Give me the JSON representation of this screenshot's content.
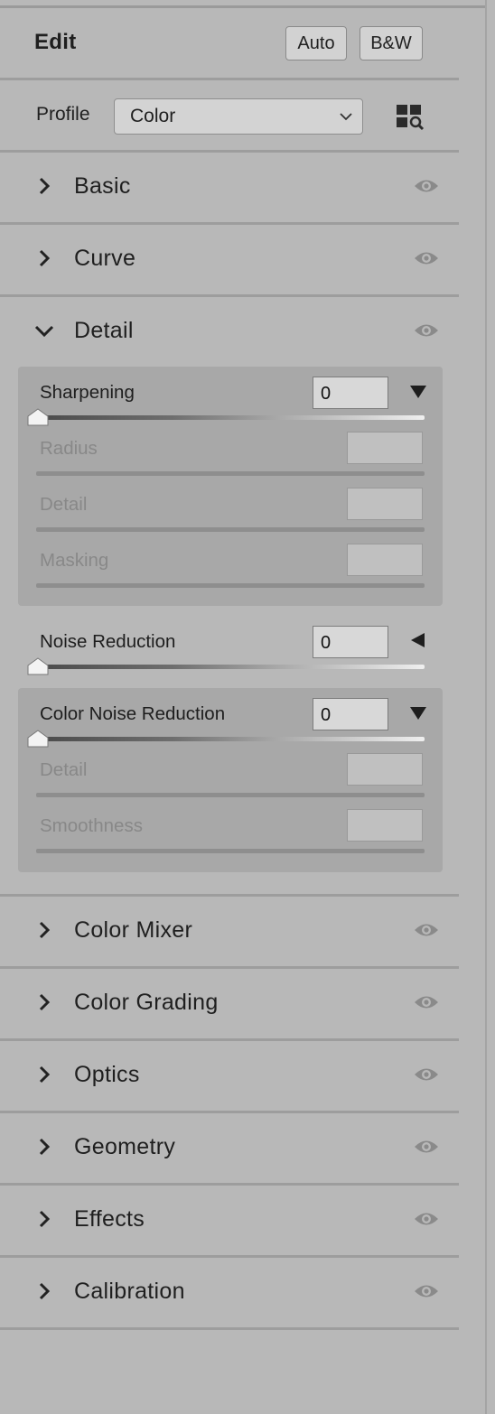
{
  "header": {
    "title": "Edit",
    "auto_label": "Auto",
    "bw_label": "B&W"
  },
  "profile": {
    "label": "Profile",
    "value": "Color",
    "browse_icon": "profile-browser-icon"
  },
  "sections_top": [
    {
      "name": "Basic",
      "expanded": false
    },
    {
      "name": "Curve",
      "expanded": false
    },
    {
      "name": "Detail",
      "expanded": true
    }
  ],
  "detail": {
    "sharpening": {
      "label": "Sharpening",
      "value": "0",
      "level": 0,
      "radius_label": "Radius",
      "detail_label": "Detail",
      "masking_label": "Masking"
    },
    "noise_reduction": {
      "label": "Noise Reduction",
      "value": "0",
      "level": 0
    },
    "color_noise_reduction": {
      "label": "Color Noise Reduction",
      "value": "0",
      "level": 0,
      "detail_label": "Detail",
      "smoothness_label": "Smoothness"
    }
  },
  "sections_bottom": [
    {
      "name": "Color Mixer"
    },
    {
      "name": "Color Grading"
    },
    {
      "name": "Optics"
    },
    {
      "name": "Geometry"
    },
    {
      "name": "Effects"
    },
    {
      "name": "Calibration"
    }
  ],
  "colors": {
    "panel_bg": "#b8b8b8",
    "subpanel_bg": "#a8a8a8",
    "text": "#1f1f1f",
    "disabled_text": "#888888"
  }
}
